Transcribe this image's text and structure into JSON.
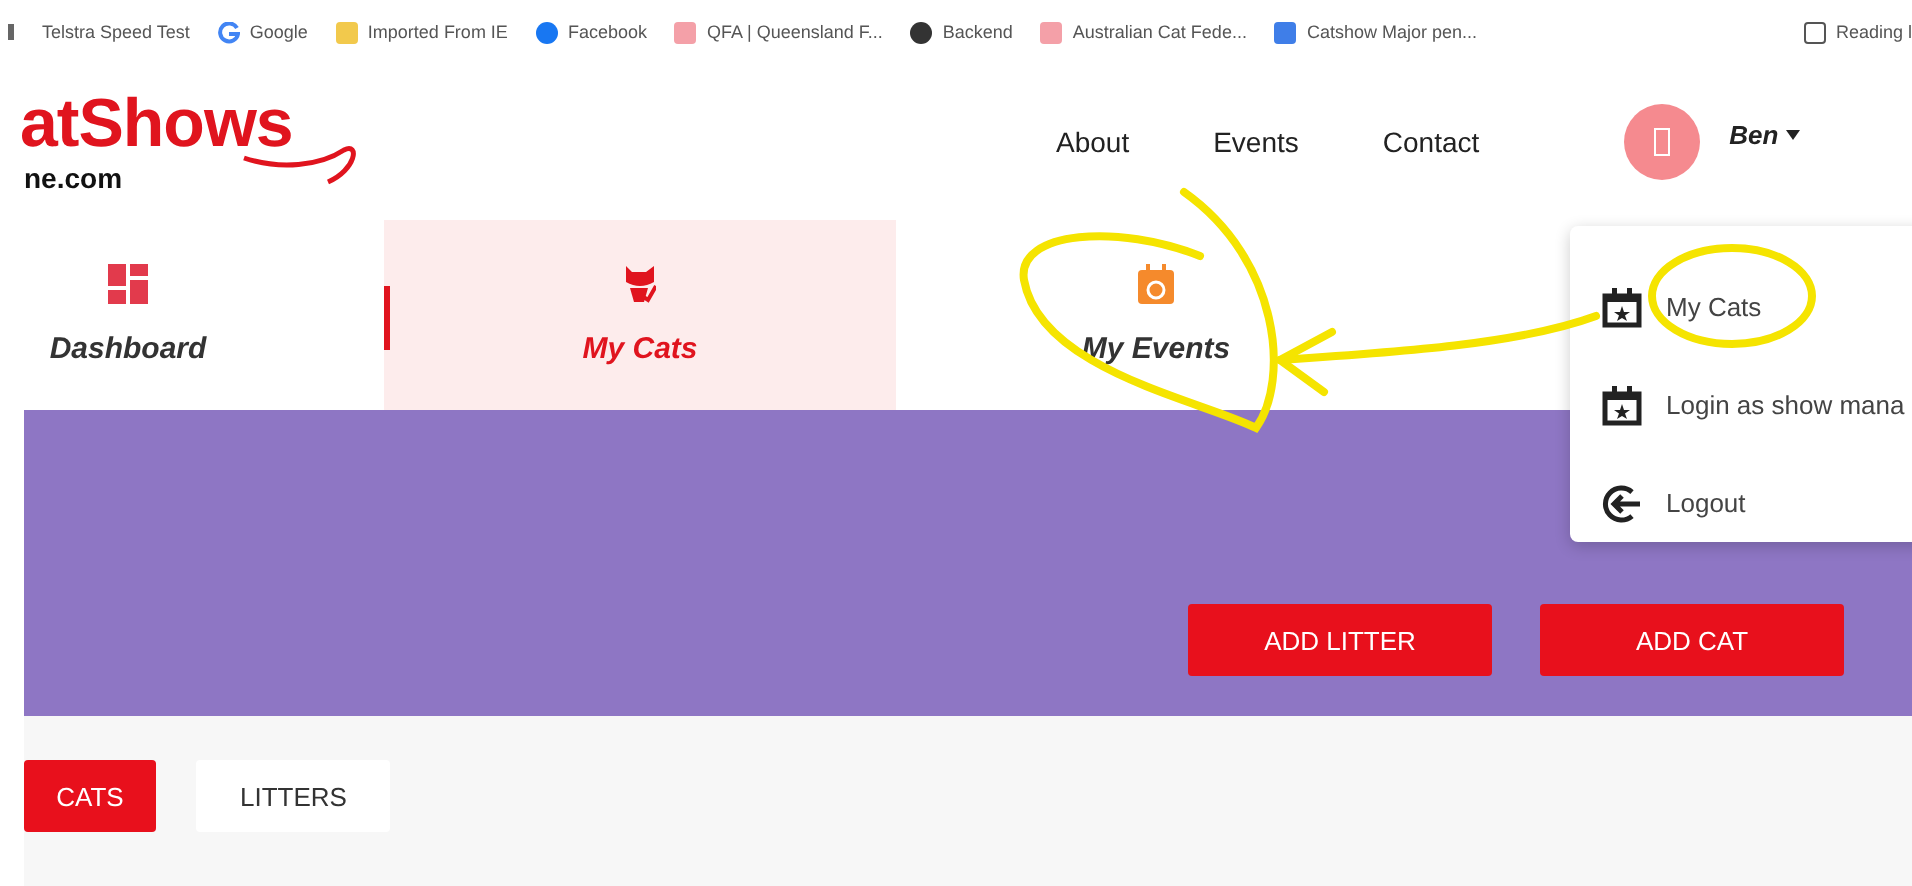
{
  "bookmarks_bar": [
    {
      "label": "Telstra Speed Test",
      "kind": "page"
    },
    {
      "label": "Google",
      "kind": "google"
    },
    {
      "label": "Imported From IE",
      "kind": "folder"
    },
    {
      "label": "Facebook",
      "kind": "facebook"
    },
    {
      "label": "QFA | Queensland F...",
      "kind": "cat"
    },
    {
      "label": "Backend",
      "kind": "globe"
    },
    {
      "label": "Australian Cat Fede...",
      "kind": "cat"
    },
    {
      "label": "Catshow Major pen...",
      "kind": "doc"
    }
  ],
  "reading_list": {
    "label": "Reading l"
  },
  "logo": {
    "name": "atShows",
    "domain": "ne.com"
  },
  "nav": [
    "About",
    "Events",
    "Contact"
  ],
  "user": {
    "name": "Ben"
  },
  "section_tabs": [
    {
      "label": "Dashboard",
      "kind": "dashboard",
      "selected": false
    },
    {
      "label": "My Cats",
      "kind": "cat",
      "selected": true
    },
    {
      "label": "My Events",
      "kind": "calendar",
      "selected": false
    }
  ],
  "user_menu": [
    {
      "label": "My Cats",
      "kind": "calendar"
    },
    {
      "label": "Login as show mana",
      "kind": "calendar"
    },
    {
      "label": "Logout",
      "kind": "logout"
    }
  ],
  "actions": [
    "ADD LITTER",
    "ADD CAT"
  ],
  "list_tabs": [
    {
      "label": "CATS",
      "selected": true
    },
    {
      "label": "LITTERS",
      "selected": false
    }
  ]
}
